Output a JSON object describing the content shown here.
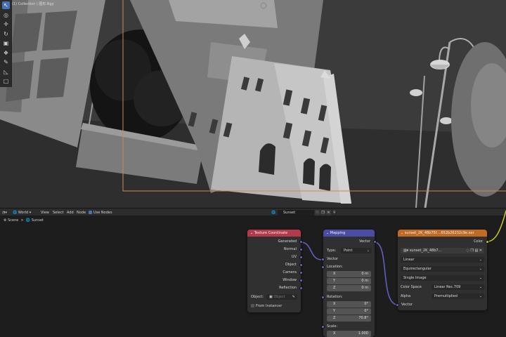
{
  "viewport": {
    "header_text": "(1) Collection | 图形.Ngy",
    "tools": [
      {
        "icon": "tweak-icon",
        "glyph": "↖"
      },
      {
        "icon": "cursor-icon",
        "glyph": "◎"
      },
      {
        "icon": "move-icon",
        "glyph": "✛"
      },
      {
        "icon": "rotate-icon",
        "glyph": "↻"
      },
      {
        "icon": "scale-icon",
        "glyph": "▣"
      },
      {
        "icon": "transform-icon",
        "glyph": "❖"
      },
      {
        "icon": "annotate-icon",
        "glyph": "✎"
      },
      {
        "icon": "measure-icon",
        "glyph": "◺"
      },
      {
        "icon": "add-cube-icon",
        "glyph": "□"
      }
    ]
  },
  "node_header": {
    "editor_icon": "node-editor-icon",
    "shader_type": "World",
    "menus": [
      "View",
      "Select",
      "Add",
      "Node"
    ],
    "use_nodes_label": "Use Nodes",
    "world_name": "Sunset",
    "pin_icon": "pin-icon"
  },
  "breadcrumb": {
    "scene": "Scene",
    "world": "Sunset"
  },
  "nodes": {
    "texture_coordinate": {
      "title": "Texture Coordinate",
      "outputs": [
        "Generated",
        "Normal",
        "UV",
        "Object",
        "Camera",
        "Window",
        "Reflection"
      ],
      "object_label": "Object:",
      "object_placeholder": "Object",
      "from_instancer": "From Instancer"
    },
    "mapping": {
      "title": "Mapping",
      "output": "Vector",
      "type_label": "Type:",
      "type_value": "Point",
      "input_vector": "Vector",
      "location_label": "Location:",
      "location": [
        {
          "axis": "X",
          "value": "0 m"
        },
        {
          "axis": "Y",
          "value": "0 m"
        },
        {
          "axis": "Z",
          "value": "0 m"
        }
      ],
      "rotation_label": "Rotation:",
      "rotation": [
        {
          "axis": "X",
          "value": "0°"
        },
        {
          "axis": "Y",
          "value": "0°"
        },
        {
          "axis": "Z",
          "value": "70.8°"
        }
      ],
      "scale_label": "Scale:",
      "scale": [
        {
          "axis": "X",
          "value": "1.000"
        }
      ]
    },
    "environment": {
      "title": "sunset_2K_48b75f....652b26232c9e.exr",
      "output": "Color",
      "image_name": "sunset_2K_48b7...",
      "interpolation": "Linear",
      "projection": "Equirectangular",
      "source": "Single Image",
      "color_space_label": "Color Space",
      "color_space": "Linear Rec.709",
      "alpha_label": "Alpha",
      "alpha": "Premultiplied",
      "input_vector": "Vector"
    }
  },
  "colors": {
    "tex_coord_header": "#b33a4a",
    "mapping_header": "#4b4ca6",
    "texture_header": "#c06a23",
    "vector_socket": "#6363c7",
    "color_socket": "#c7c729",
    "camera_frame": "#d08a4c"
  }
}
